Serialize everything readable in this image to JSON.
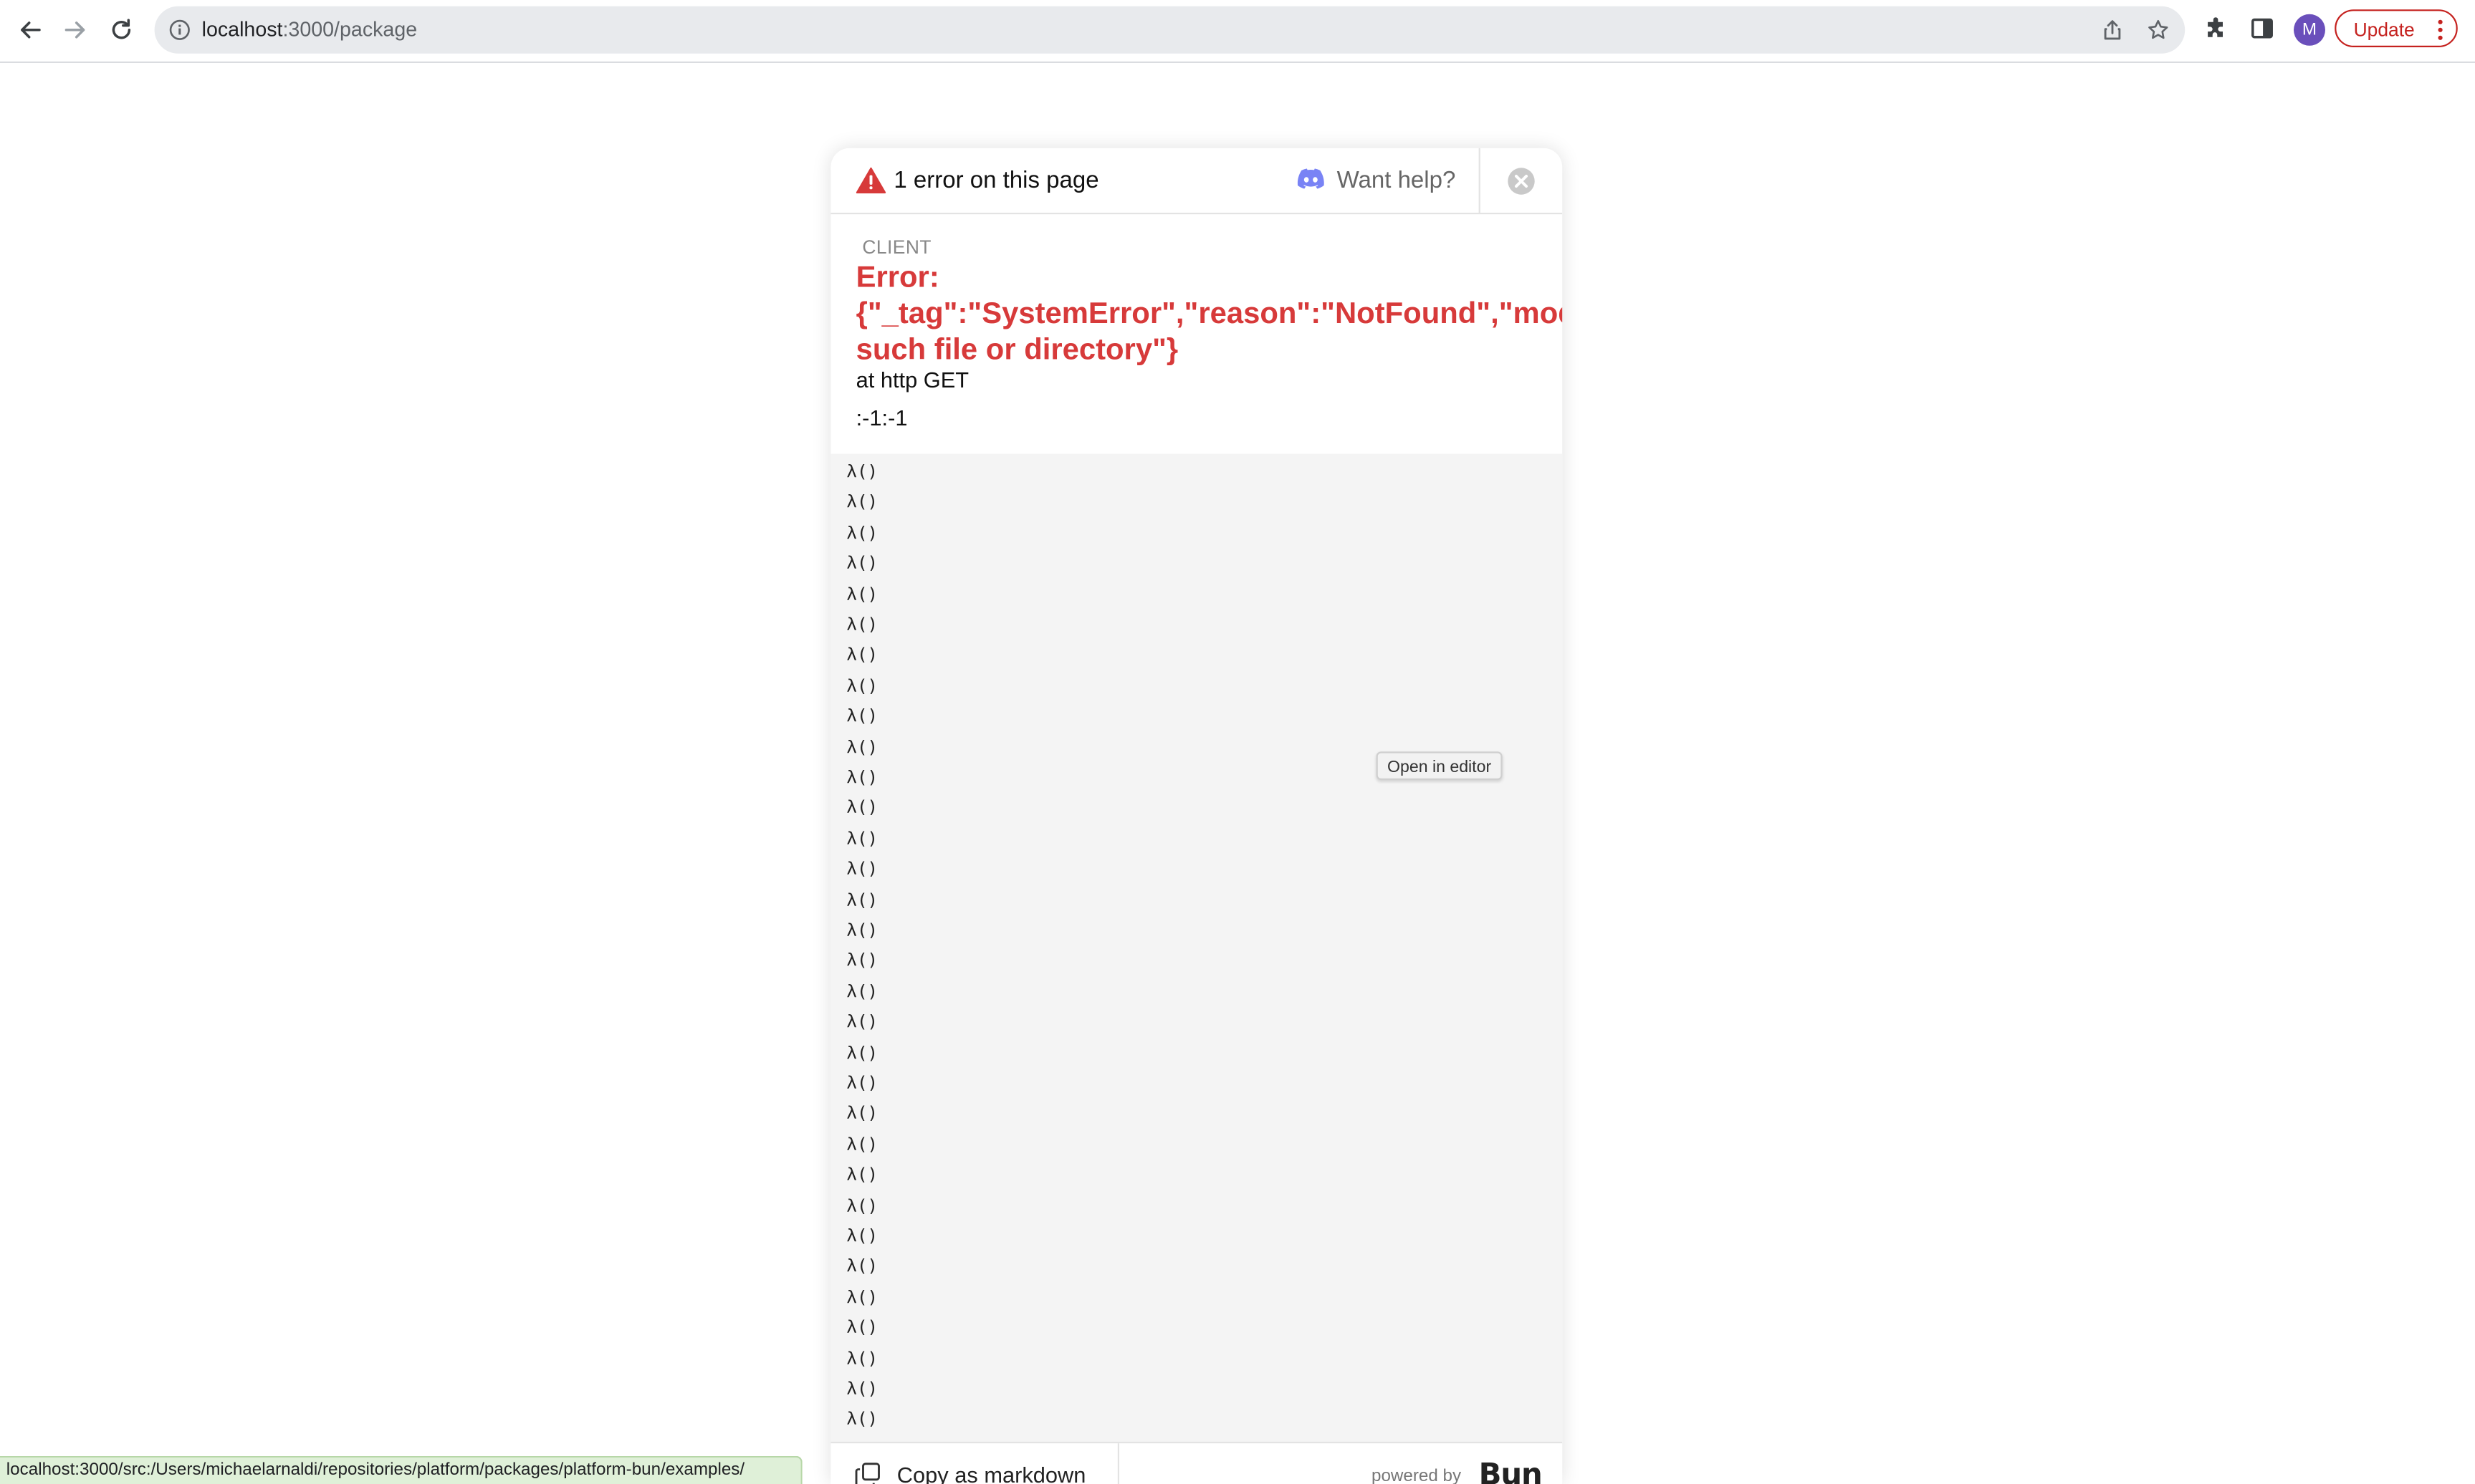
{
  "browser": {
    "url_host": "localhost",
    "url_path": ":3000/package",
    "avatar_letter": "M",
    "update_label": "Update",
    "status_url": "localhost:3000/src:/Users/michaelarnaldi/repositories/platform/packages/platform-bun/examples/"
  },
  "overlay": {
    "header": {
      "error_count": "1 error on this page",
      "help_label": "Want help?"
    },
    "error": {
      "source_label": "CLIENT",
      "title_lines": [
        "Error:",
        "{\"_tag\":\"SystemError\",\"reason\":\"NotFound\",\"module\":\"FileSystem\",\"method\":\"stat\",\"pathOrDescriptor\":\"./pack",
        "such file or directory\"}"
      ],
      "location": "at http GET",
      "position": ":-1:-1"
    },
    "stack": {
      "frames": [
        "λ()",
        "λ()",
        "λ()",
        "λ()",
        "λ()",
        "λ()",
        "λ()",
        "λ()",
        "λ()",
        "λ()",
        "λ()",
        "λ()",
        "λ()",
        "λ()",
        "λ()",
        "λ()",
        "λ()",
        "λ()",
        "λ()",
        "λ()",
        "λ()",
        "λ()",
        "λ()",
        "λ()",
        "λ()",
        "λ()",
        "λ()",
        "λ()",
        "λ()",
        "λ()",
        "λ()",
        "λ()"
      ],
      "tooltip": "Open in editor"
    },
    "footer": {
      "copy_label": "Copy as markdown",
      "powered_by": "powered by",
      "brand": "Bun"
    }
  },
  "colors": {
    "error_red": "#d73a3a",
    "update_red": "#c5221f",
    "discord": "#5865f2",
    "avatar": "#6a4fbb"
  },
  "icons": [
    "back-arrow-icon",
    "forward-arrow-icon",
    "reload-icon",
    "info-icon",
    "share-icon",
    "star-icon",
    "extensions-icon",
    "side-panel-icon",
    "more-vertical-icon",
    "warning-triangle-icon",
    "discord-icon",
    "close-circle-icon",
    "copy-icon"
  ]
}
